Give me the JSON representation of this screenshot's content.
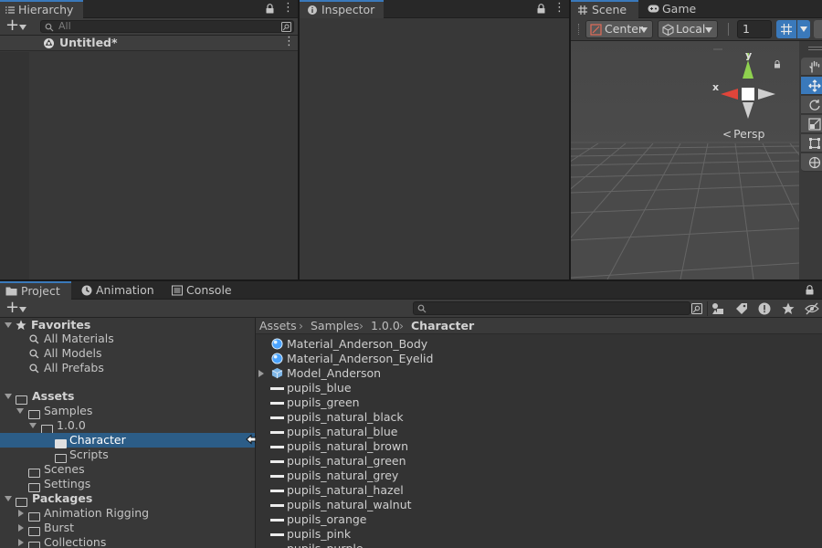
{
  "hierarchy": {
    "tab_label": "Hierarchy",
    "search_placeholder": "All",
    "scene_name": "Untitled*"
  },
  "inspector": {
    "tab_label": "Inspector"
  },
  "scene_view": {
    "tabs": [
      {
        "label": "Scene",
        "icon": "grid-icon"
      },
      {
        "label": "Game",
        "icon": "gamepad-icon"
      }
    ],
    "pivot_mode": "Center",
    "pivot_rotation": "Local",
    "grid_snap_value": "1",
    "projection_label": "Persp",
    "gizmo_axes": {
      "x": "x",
      "y": "y"
    },
    "tool_icons": [
      "hand-tool-icon",
      "move-tool-icon",
      "rotate-tool-icon",
      "scale-tool-icon",
      "rect-tool-icon",
      "transform-tool-icon"
    ],
    "axis_colors": {
      "x": "#e0453a",
      "y": "#8fd14f",
      "z": "#c4c4c4"
    }
  },
  "bottom_tabs": [
    {
      "label": "Project",
      "icon": "folder-icon"
    },
    {
      "label": "Animation",
      "icon": "animation-icon"
    },
    {
      "label": "Console",
      "icon": "console-icon"
    }
  ],
  "project": {
    "tree": {
      "favorites": {
        "label": "Favorites",
        "items": [
          "All Materials",
          "All Models",
          "All Prefabs"
        ]
      },
      "assets": {
        "label": "Assets",
        "samples": "Samples",
        "version": "1.0.0",
        "character": "Character",
        "scripts": "Scripts",
        "scenes": "Scenes",
        "settings": "Settings"
      },
      "packages": {
        "label": "Packages",
        "items": [
          "Animation Rigging",
          "Burst",
          "Collections"
        ]
      }
    },
    "breadcrumb": [
      "Assets",
      "Samples",
      "1.0.0",
      "Character"
    ],
    "files": [
      {
        "name": "Material_Anderson_Body",
        "kind": "material"
      },
      {
        "name": "Material_Anderson_Eyelid",
        "kind": "material"
      },
      {
        "name": "Model_Anderson",
        "kind": "model"
      },
      {
        "name": "pupils_blue",
        "kind": "texture"
      },
      {
        "name": "pupils_green",
        "kind": "texture"
      },
      {
        "name": "pupils_natural_black",
        "kind": "texture"
      },
      {
        "name": "pupils_natural_blue",
        "kind": "texture"
      },
      {
        "name": "pupils_natural_brown",
        "kind": "texture"
      },
      {
        "name": "pupils_natural_green",
        "kind": "texture"
      },
      {
        "name": "pupils_natural_grey",
        "kind": "texture"
      },
      {
        "name": "pupils_natural_hazel",
        "kind": "texture"
      },
      {
        "name": "pupils_natural_walnut",
        "kind": "texture"
      },
      {
        "name": "pupils_orange",
        "kind": "texture"
      },
      {
        "name": "pupils_pink",
        "kind": "texture"
      },
      {
        "name": "pupils_purple",
        "kind": "texture"
      }
    ]
  },
  "colors": {
    "selection": "#2c5d87",
    "accent": "#3a79bb",
    "material_blue": "#4aa3ff"
  }
}
